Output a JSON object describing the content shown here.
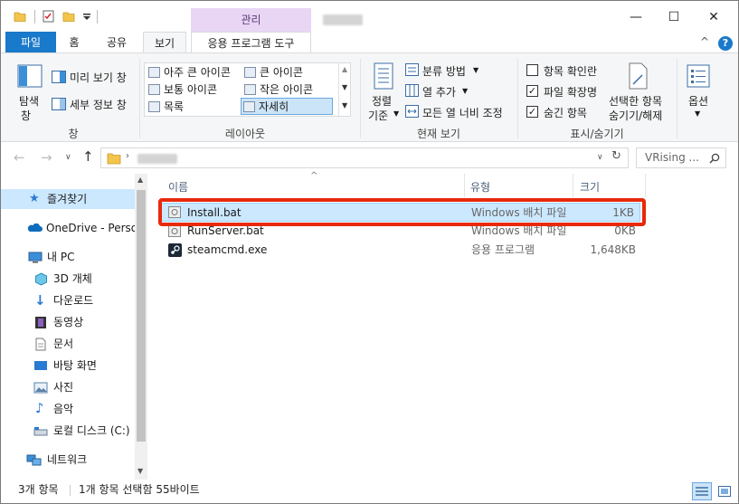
{
  "titlebar": {
    "manage_tab": "관리",
    "minimize": "—",
    "maximize": "☐",
    "close": "✕"
  },
  "tabs": {
    "file": "파일",
    "home": "홈",
    "share": "공유",
    "view": "보기",
    "app_tools": "응용 프로그램 도구",
    "collapse": "^",
    "help": "?"
  },
  "ribbon": {
    "pane_group": {
      "nav_pane": "탐색",
      "nav_pane_2": "창",
      "preview": "미리 보기 창",
      "details": "세부 정보 창",
      "label": "창"
    },
    "layout_group": {
      "items": [
        "아주 큰 아이콘",
        "큰 아이콘",
        "보통 아이콘",
        "작은 아이콘",
        "목록",
        "자세히"
      ],
      "label": "레이아웃"
    },
    "current_view_group": {
      "sort_by": "정렬",
      "sort_by_2": "기준",
      "group_by": "분류 방법",
      "add_columns": "열 추가",
      "size_all_columns": "모든 열 너비 조정",
      "label": "현재 보기"
    },
    "show_hide_group": {
      "item_checkboxes": "항목 확인란",
      "file_extensions": "파일 확장명",
      "hidden_items": "숨긴 항목",
      "hide_selected": "선택한 항목",
      "hide_selected_2": "숨기기/해제",
      "label": "표시/숨기기"
    },
    "options": "옵션"
  },
  "navbar": {
    "search_placeholder": "VRising ..."
  },
  "navpane": {
    "items": [
      {
        "label": "즐겨찾기"
      },
      {
        "label": "OneDrive - Person"
      },
      {
        "label": "내 PC"
      },
      {
        "label": "3D 개체"
      },
      {
        "label": "다운로드"
      },
      {
        "label": "동영상"
      },
      {
        "label": "문서"
      },
      {
        "label": "바탕 화면"
      },
      {
        "label": "사진"
      },
      {
        "label": "음악"
      },
      {
        "label": "로컬 디스크 (C:)"
      },
      {
        "label": "네트워크"
      }
    ]
  },
  "filelist": {
    "columns": {
      "name": "이름",
      "type": "유형",
      "size": "크기"
    },
    "rows": [
      {
        "name": "Install.bat",
        "type": "Windows 배치 파일",
        "size": "1KB"
      },
      {
        "name": "RunServer.bat",
        "type": "Windows 배치 파일",
        "size": "0KB"
      },
      {
        "name": "steamcmd.exe",
        "type": "응용 프로그램",
        "size": "1,648KB"
      }
    ]
  },
  "status": {
    "item_count": "3개 항목",
    "selection": "1개 항목 선택함 55바이트"
  },
  "colors": {
    "file_tab": "#1979ca",
    "manage_tab": "#e9d6f5",
    "selection": "#cce8ff",
    "highlight_box": "#e8290b"
  }
}
